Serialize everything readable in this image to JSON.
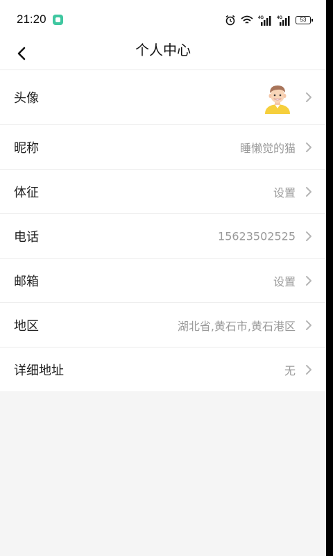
{
  "status_bar": {
    "time": "21:20",
    "battery": "53",
    "icons": [
      "alarm-icon",
      "wifi-icon",
      "signal-4g-icon",
      "signal-4g-icon",
      "battery-icon"
    ]
  },
  "header": {
    "title": "个人中心",
    "back_icon": "back-arrow-icon"
  },
  "profile": {
    "avatar_label": "头像",
    "nickname_label": "昵称",
    "nickname_value": "睡懒觉的猫",
    "body_label": "体征",
    "body_value": "设置",
    "phone_label": "电话",
    "phone_value": "15623502525",
    "email_label": "邮箱",
    "email_value": "设置",
    "region_label": "地区",
    "region_value": "湖北省,黄石市,黄石港区",
    "address_label": "详细地址",
    "address_value": "无"
  },
  "colors": {
    "accent_app": "#3fc7a0",
    "value_text": "#9a9a9a",
    "background": "#f5f5f5"
  }
}
